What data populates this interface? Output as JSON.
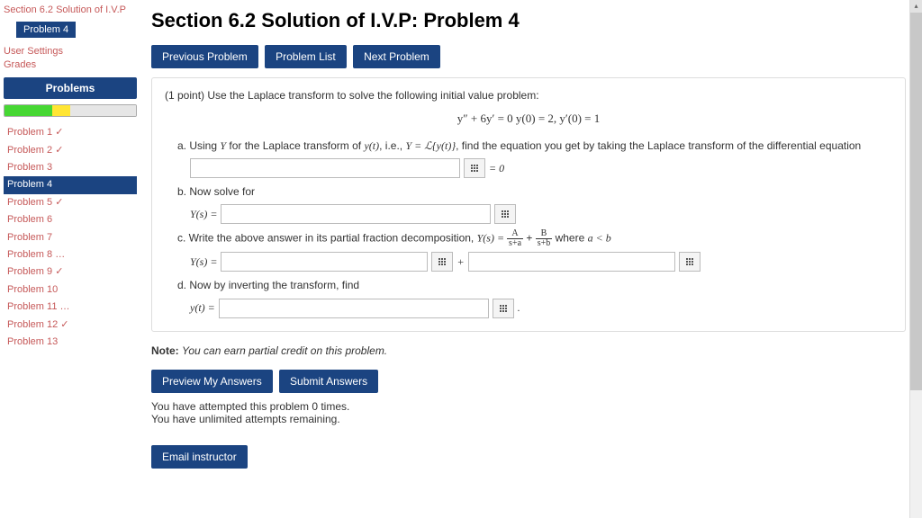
{
  "sidebar": {
    "breadcrumb1": "Section 6.2 Solution of I.V.P",
    "current": "Problem 4",
    "links": [
      "User Settings",
      "Grades"
    ],
    "problems_header": "Problems",
    "progress": {
      "green_pct": 36,
      "yellow_pct": 14
    },
    "problems": [
      {
        "label": "Problem 1 ✓",
        "active": false
      },
      {
        "label": "Problem 2 ✓",
        "active": false
      },
      {
        "label": "Problem 3",
        "active": false
      },
      {
        "label": "Problem 4",
        "active": true
      },
      {
        "label": "Problem 5 ✓",
        "active": false
      },
      {
        "label": "Problem 6",
        "active": false
      },
      {
        "label": "Problem 7",
        "active": false
      },
      {
        "label": "Problem 8 …",
        "active": false
      },
      {
        "label": "Problem 9 ✓",
        "active": false
      },
      {
        "label": "Problem 10",
        "active": false
      },
      {
        "label": "Problem 11 …",
        "active": false
      },
      {
        "label": "Problem 12 ✓",
        "active": false
      },
      {
        "label": "Problem 13",
        "active": false
      }
    ]
  },
  "main": {
    "title": "Section 6.2 Solution of I.V.P: Problem 4",
    "nav": {
      "prev": "Previous Problem",
      "list": "Problem List",
      "next": "Next Problem"
    },
    "intro": "(1 point) Use the Laplace transform to solve the following initial value problem:",
    "equation": "y″ + 6y′ = 0        y(0) = 2,  y′(0) = 1",
    "part_a_pre": "a. Using ",
    "part_a_Y": "Y",
    "part_a_mid1": " for the Laplace transform of ",
    "part_a_yt": "y(t)",
    "part_a_mid2": ", i.e., ",
    "part_a_eqdef": "Y = ℒ{y(t)}",
    "part_a_post": ", find the equation you get by taking the Laplace transform of the differential equation",
    "eq_zero": "= 0",
    "part_b": "b. Now solve for",
    "Ys_eq": "Y(s) =",
    "part_c_pre": "c. Write the above answer in its partial fraction decomposition, ",
    "part_c_eq": "Y(s) = ",
    "part_c_frac1_top": "A",
    "part_c_frac1_bot": "s+a",
    "part_c_plus": " + ",
    "part_c_frac2_top": "B",
    "part_c_frac2_bot": "s+b",
    "part_c_where": " where ",
    "part_c_cond": "a < b",
    "plus_sign": "+",
    "part_d": "d. Now by inverting the transform, find",
    "yt_eq": "y(t) =",
    "period": ".",
    "note_label": "Note:",
    "note_text": "You can earn partial credit on this problem.",
    "preview": "Preview My Answers",
    "submit": "Submit Answers",
    "attempts1": "You have attempted this problem 0 times.",
    "attempts2": "You have unlimited attempts remaining.",
    "email": "Email instructor"
  }
}
